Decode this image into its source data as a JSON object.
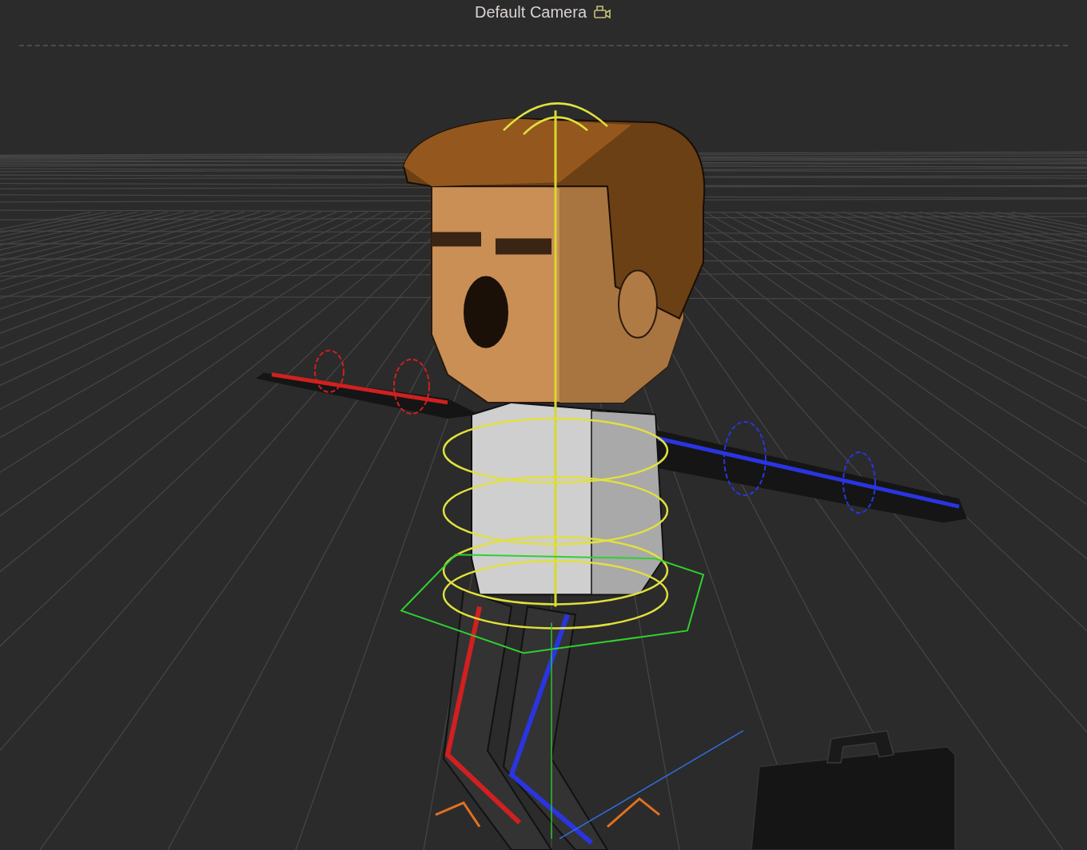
{
  "viewport": {
    "camera_label": "Default Camera"
  }
}
